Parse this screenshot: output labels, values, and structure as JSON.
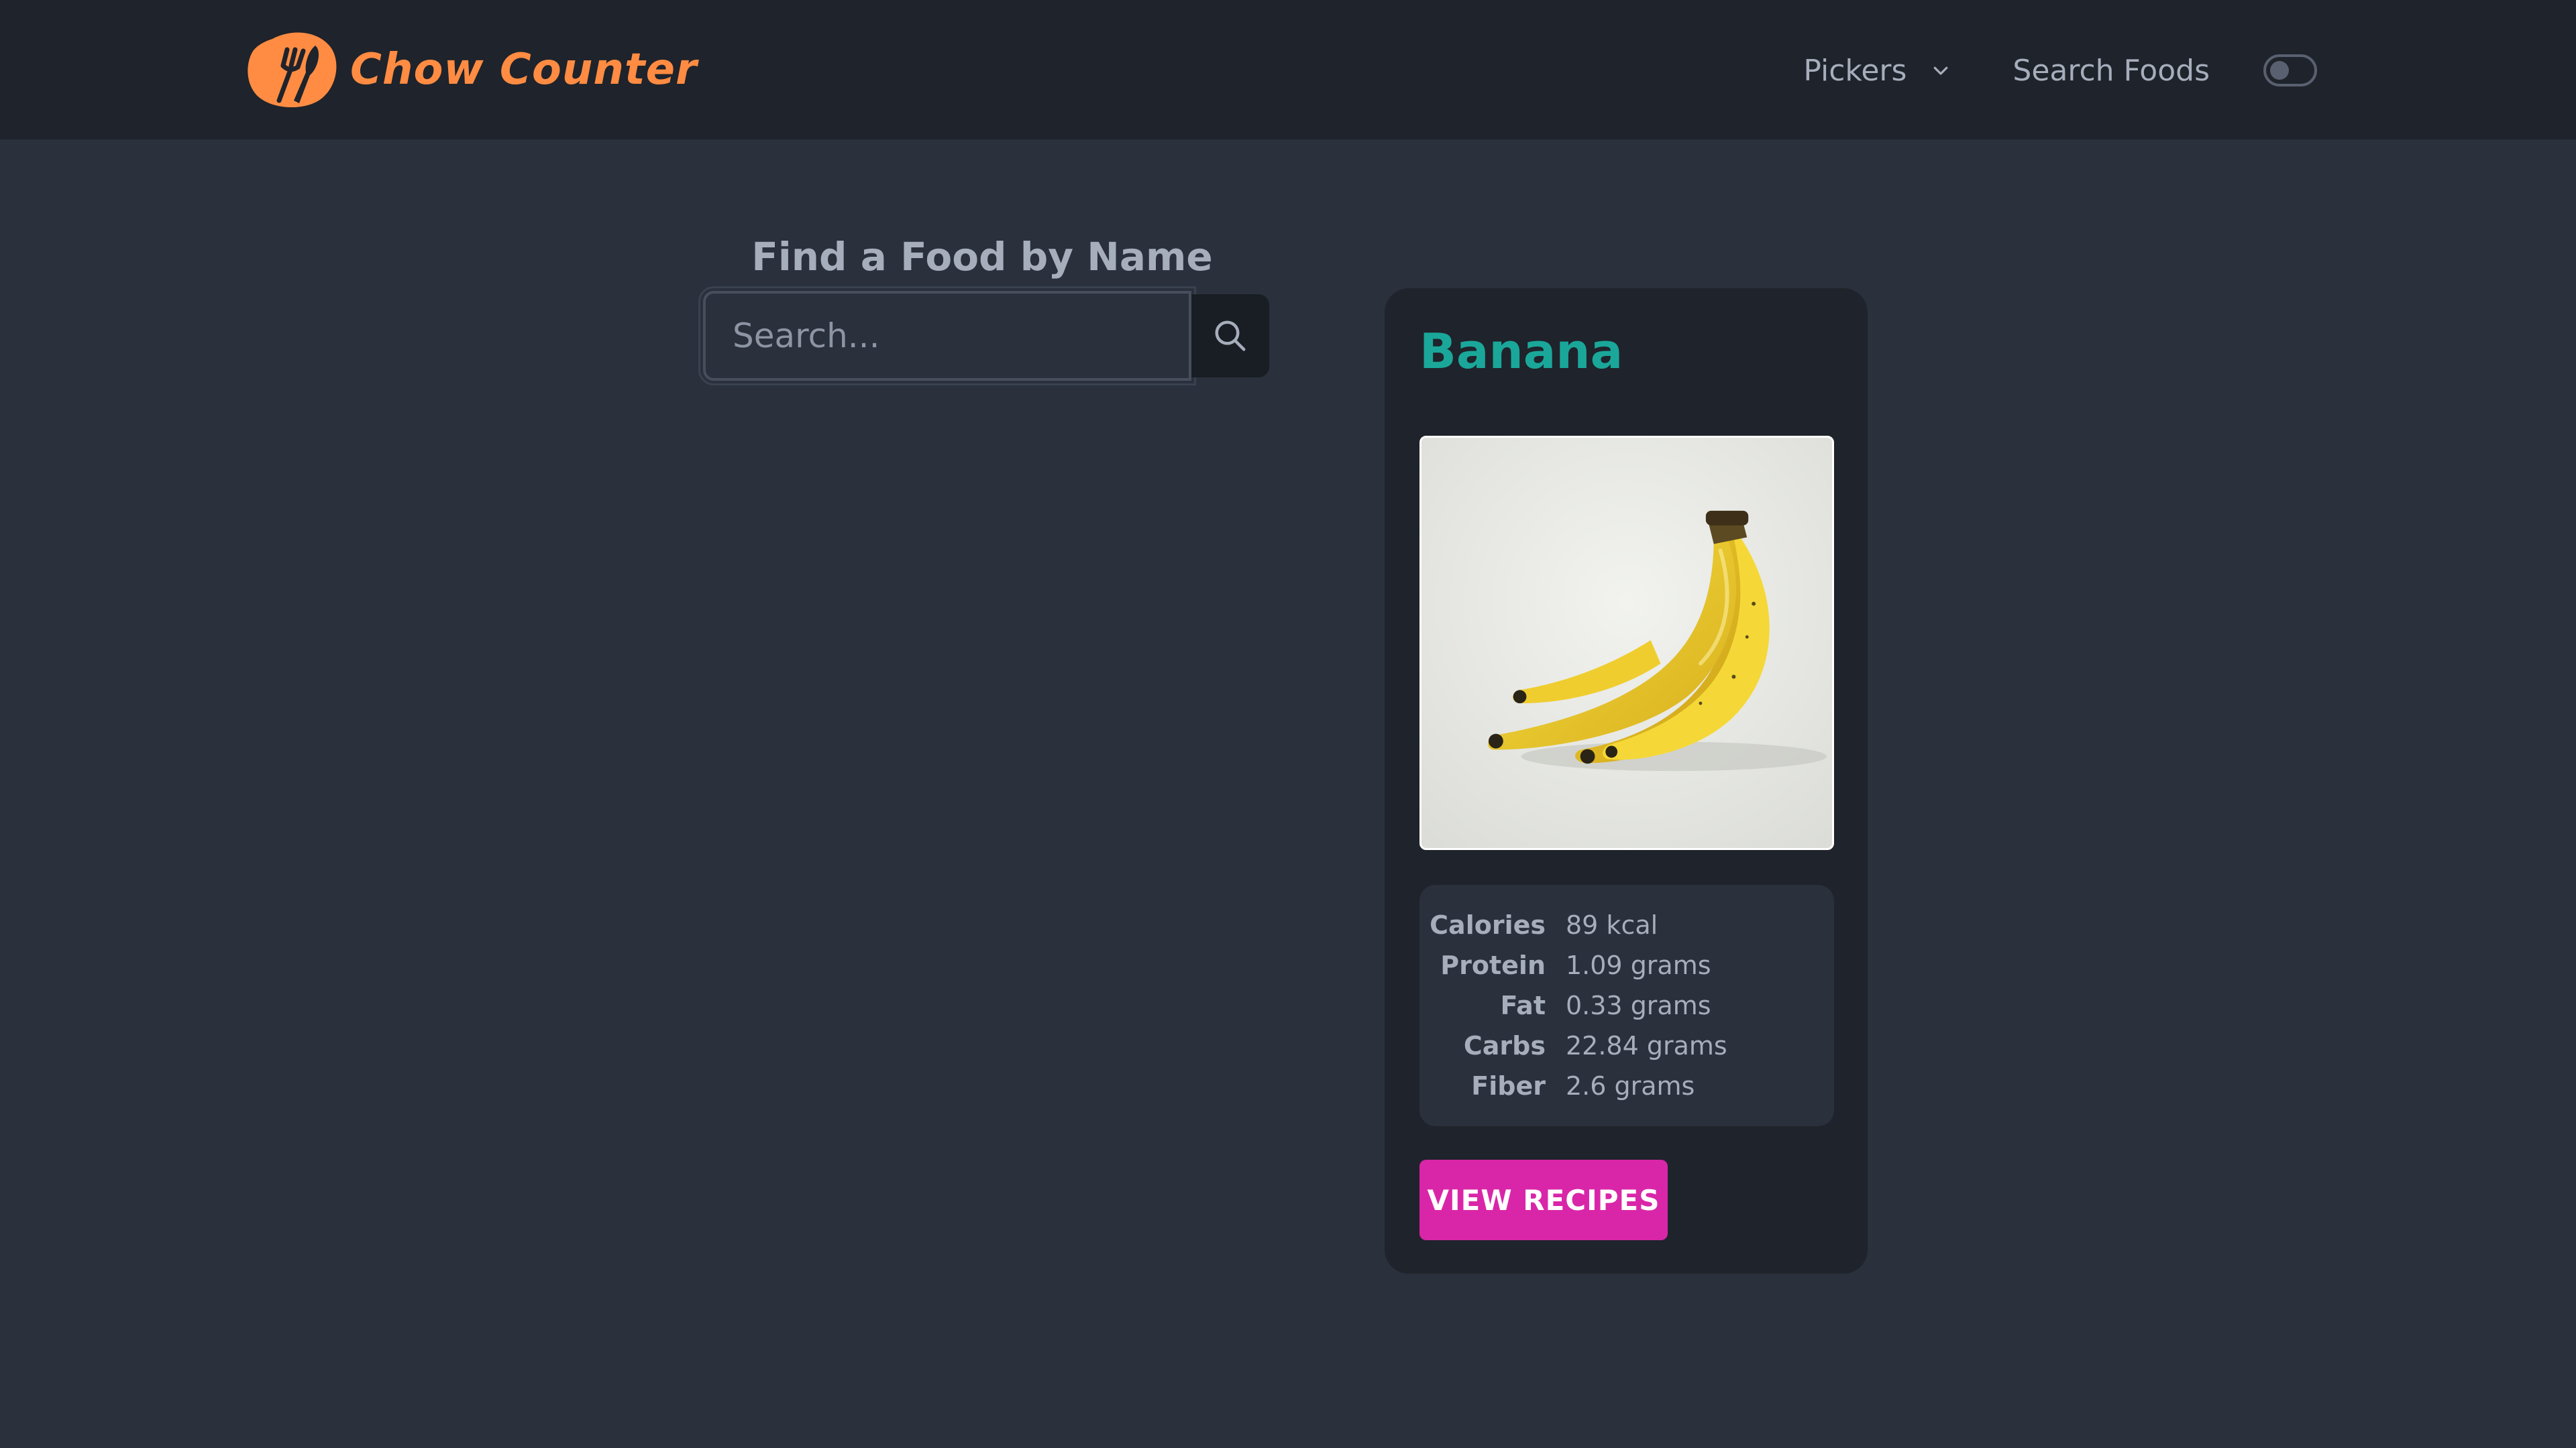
{
  "brand": {
    "name": "Chow Counter",
    "logo_icon": "fork-and-knife-logo-icon",
    "color": "#ff8c42"
  },
  "nav": {
    "pickers_label": "Pickers",
    "pickers_icon": "chevron-down-icon",
    "search_label": "Search Foods",
    "theme_toggle": {
      "icon": "toggle-switch",
      "checked": false
    }
  },
  "search": {
    "title": "Find a Food by Name",
    "placeholder": "Search...",
    "value": "",
    "button_icon": "search-icon"
  },
  "food": {
    "name": "Banana",
    "name_color": "#1aa79a",
    "image_subject": "banana-bunch",
    "nutrients": [
      {
        "label": "Calories",
        "value": "89 kcal"
      },
      {
        "label": "Protein",
        "value": "1.09 grams"
      },
      {
        "label": "Fat",
        "value": "0.33 grams"
      },
      {
        "label": "Carbs",
        "value": "22.84 grams"
      },
      {
        "label": "Fiber",
        "value": "2.6 grams"
      }
    ],
    "recipes_button": "VIEW RECIPES",
    "recipes_button_color": "#d926a9"
  },
  "colors": {
    "page_bg": "#2a303c",
    "nav_bg": "#1f232b",
    "text": "#a6adbb"
  }
}
